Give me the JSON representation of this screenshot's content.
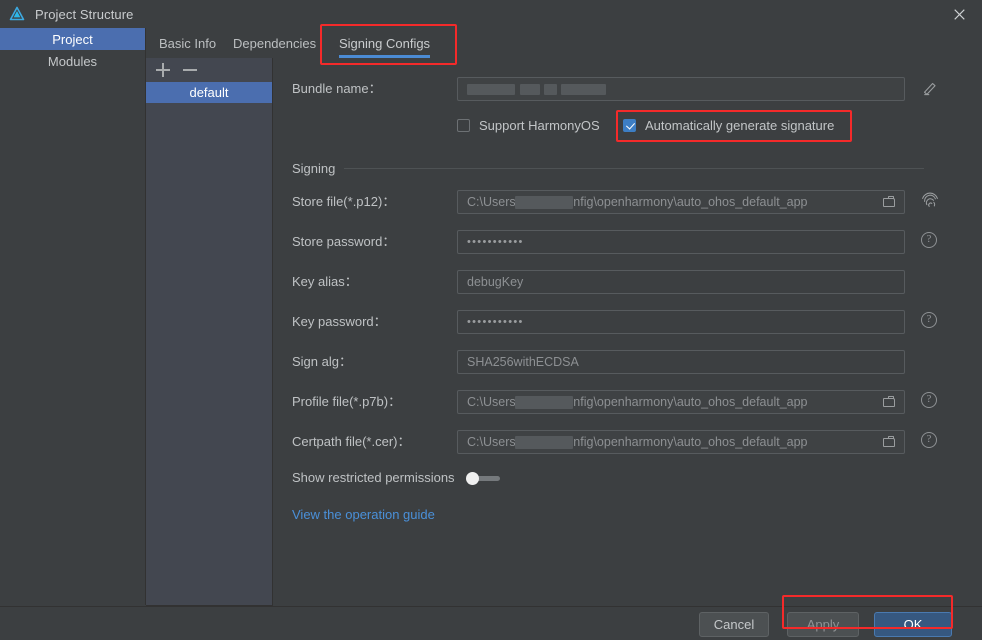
{
  "window": {
    "title": "Project Structure",
    "logo_icon": "deveco-logo-icon",
    "close_icon": "close-icon"
  },
  "sidebar": {
    "items": [
      {
        "label": "Project",
        "selected": true
      },
      {
        "label": "Modules",
        "selected": false
      }
    ]
  },
  "tabs": [
    {
      "label": "Basic Info",
      "active": false
    },
    {
      "label": "Dependencies",
      "active": false
    },
    {
      "label": "Signing Configs",
      "active": true
    }
  ],
  "configs_panel": {
    "add_icon": "plus-icon",
    "remove_icon": "minus-icon",
    "items": [
      {
        "label": "default",
        "selected": true
      }
    ]
  },
  "form": {
    "bundle_name": {
      "label": "Bundle name：",
      "value": "",
      "redacted": true,
      "edit_icon": "pencil-edit-icon"
    },
    "checkboxes": [
      {
        "label": "Support HarmonyOS",
        "checked": false
      },
      {
        "label": "Automatically generate signature",
        "checked": true
      }
    ],
    "section_title": "Signing",
    "fields": [
      {
        "label": "Store file(*.p12)：",
        "value": "C:\\Users\\            \\.ohos\\config\\openharmony\\auto_ohos_default_app",
        "prefix": "C:\\Users\\",
        "suffix": "\\.ohos\\config\\openharmony\\auto_ohos_default_app",
        "redacted": true,
        "has_folder_icon": true,
        "side_icon": "fingerprint-icon"
      },
      {
        "label": "Store password：",
        "value": "•••••••••••",
        "redacted": false,
        "has_folder_icon": false,
        "side_icon": "help-circle-icon"
      },
      {
        "label": "Key alias：",
        "value": "debugKey",
        "redacted": false,
        "has_folder_icon": false,
        "side_icon": ""
      },
      {
        "label": "Key password：",
        "value": "•••••••••••",
        "redacted": false,
        "has_folder_icon": false,
        "side_icon": "help-circle-icon"
      },
      {
        "label": "Sign alg：",
        "value": "SHA256withECDSA",
        "redacted": false,
        "has_folder_icon": false,
        "side_icon": ""
      },
      {
        "label": "Profile file(*.p7b)：",
        "value": "C:\\Users\\            \\.ohos\\config\\openharmony\\auto_ohos_default_app",
        "prefix": "C:\\Users\\",
        "suffix": "\\.ohos\\config\\openharmony\\auto_ohos_default_app",
        "redacted": true,
        "has_folder_icon": true,
        "side_icon": "help-circle-icon"
      },
      {
        "label": "Certpath file(*.cer)：",
        "value": "C:\\Users\\            \\.ohos\\config\\openharmony\\auto_ohos_default_app",
        "prefix": "C:\\Users\\",
        "suffix": "\\.ohos\\config\\openharmony\\auto_ohos_default_app",
        "redacted": true,
        "has_folder_icon": true,
        "side_icon": "help-circle-icon"
      }
    ],
    "toggle": {
      "label": "Show restricted permissions",
      "on": false
    },
    "link": "View the operation guide"
  },
  "footer": {
    "cancel": "Cancel",
    "apply": "Apply",
    "ok": "OK"
  },
  "help_glyph": "?",
  "colors": {
    "accent_blue": "#4b6eaf",
    "tab_underline": "#4b8bd4",
    "checkbox_checked": "#3d7ec4",
    "primary_button": "#365880",
    "link": "#4a90d9",
    "annotation_red": "#f42a2a",
    "window_bg": "#3c3f41",
    "list_panel_bg": "#434750"
  }
}
